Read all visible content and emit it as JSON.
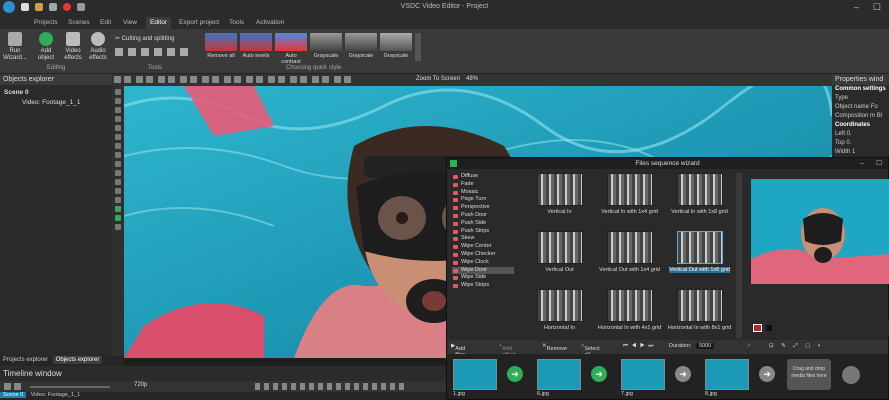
{
  "app": {
    "title": "VSDC Video Editor - Project"
  },
  "menu": [
    "Projects",
    "Scenes",
    "Edit",
    "View",
    "Editor",
    "Export project",
    "Tools",
    "Activation"
  ],
  "ribbon": {
    "run_wizard": "Run Wizard...",
    "add_object": "Add object",
    "video_effects": "Video effects",
    "audio_effects": "Audio effects",
    "editing_label": "Editing",
    "cutting": "Cutting and splitting",
    "tools_label": "Tools",
    "quick_style_label": "Choosing quick style",
    "quick_styles": [
      "Remove all",
      "Auto levels",
      "Auto contrast",
      "Grayscale",
      "Grayscale",
      "Grayscale"
    ]
  },
  "objects_explorer": {
    "title": "Objects explorer",
    "tree": [
      "Scene 0",
      "Video: Footage_1_1"
    ]
  },
  "toolbar": {
    "zoom_label": "Zoom To Screen",
    "zoom_value": "48%"
  },
  "properties": {
    "title": "Properties wind",
    "rows": [
      "Common settings",
      "Type",
      "Object name",
      "Composition m",
      "Coordinates",
      "Left",
      "Top",
      "Width"
    ],
    "vals": [
      "",
      "",
      "Fo",
      "Bl",
      "",
      "0.",
      "0.",
      "1"
    ]
  },
  "bottom_tabs": [
    "Projects explorer",
    "Objects explorer"
  ],
  "timeline": {
    "title": "Timeline window",
    "resolution": "720p",
    "tabs": [
      "Scene 0",
      "Video: Footage_1_1"
    ]
  },
  "wizard": {
    "title": "Files sequence wizard",
    "transitions": [
      "Diffuse",
      "Fade",
      "Mosaic",
      "Page Turn",
      "Perspective",
      "Push Door",
      "Push Side",
      "Push Strips",
      "Skew",
      "Wipe Center",
      "Wipe Checker",
      "Wipe Clock",
      "Wipe Door",
      "Wipe Side",
      "Wipe Strips"
    ],
    "selected_transition": "Wipe Door",
    "grid": [
      [
        "Vertical In",
        "Vertical In with 1x4 grid",
        "Vertical In with 1x8 grid"
      ],
      [
        "Vertical Out",
        "Vertical Out with 1x4 grid",
        "Vertical Out with 1x8 grid"
      ],
      [
        "Horizontal In",
        "Horizontal In with 4x1 grid",
        "Horizontal In with 8x1 grid"
      ]
    ],
    "selected_grid": "Vertical Out with 1x8 grid",
    "toolbar": {
      "add_files": "Add files",
      "add_effect": "Add effect",
      "remove": "Remove",
      "select_all": "Select all",
      "duration_label": "Duration:",
      "duration_value": "5000"
    },
    "files": [
      "1.jpg",
      "6.jpg",
      "7.jpg",
      "8.jpg"
    ],
    "drop_text": "Drag and drop media files here"
  }
}
